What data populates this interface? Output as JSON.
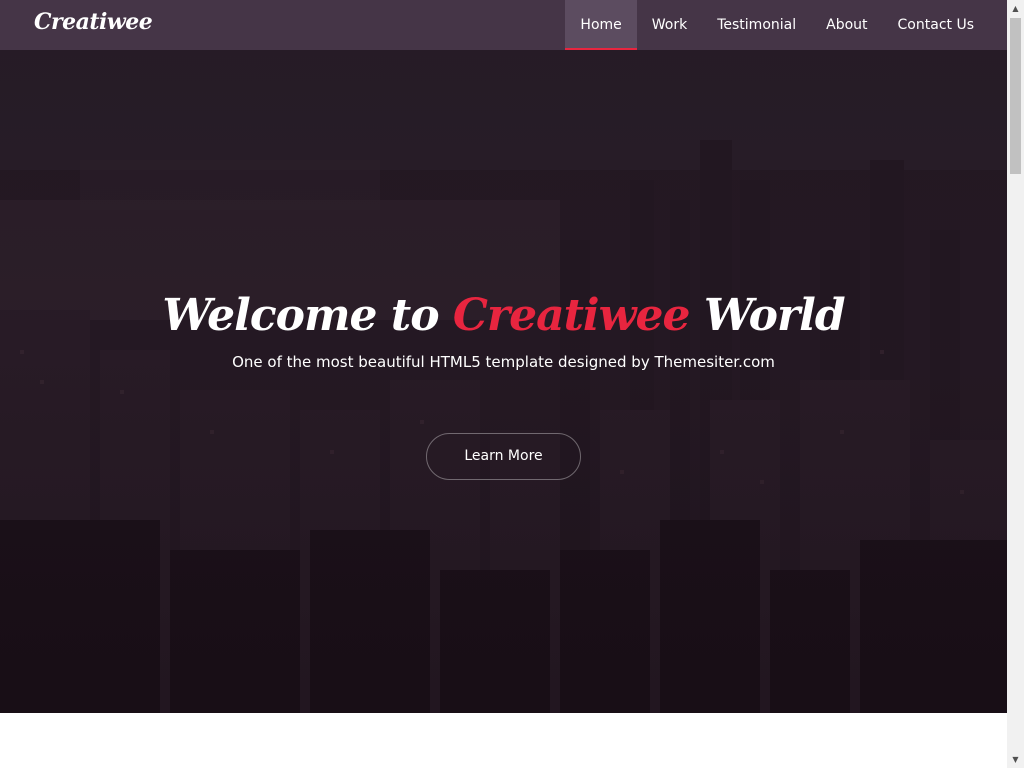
{
  "navbar": {
    "brand": "Creatiwee",
    "items": [
      {
        "label": "Home",
        "active": true
      },
      {
        "label": "Work",
        "active": false
      },
      {
        "label": "Testimonial",
        "active": false
      },
      {
        "label": "About",
        "active": false
      },
      {
        "label": "Contact Us",
        "active": false
      }
    ]
  },
  "hero": {
    "title_prefix": "Welcome to",
    "title_accent": "Creatiwee",
    "title_suffix": "World",
    "subtitle": "One of the most beautiful HTML5 template designed by Themesiter.com",
    "cta_label": "Learn More"
  },
  "scrollbar": {
    "up_icon": "scroll-up-arrow-icon",
    "down_icon": "scroll-down-arrow-icon"
  },
  "colors": {
    "navbar_bg": "#453547",
    "nav_active_bg": "#5c4c60",
    "accent": "#e8253f",
    "text": "#ffffff"
  }
}
